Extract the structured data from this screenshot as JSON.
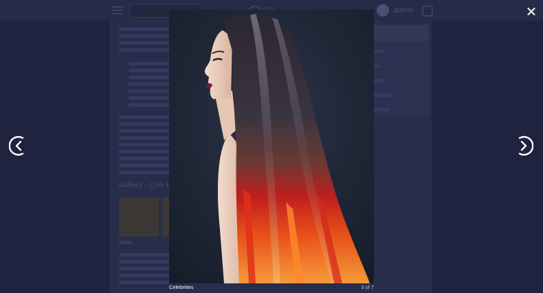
{
  "background_page": {
    "header": {
      "logo_text": "Clo",
      "username": "admin",
      "menu_icon": "hamburger-icon",
      "logout_icon": "logout-icon"
    },
    "gallery_heading": "Gallery – Link to m"
  },
  "lightbox": {
    "close_icon": "close-icon",
    "close_symbol": "✕",
    "prev_icon": "chevron-left-circle-icon",
    "next_icon": "chevron-right-circle-icon",
    "caption": "Celebrities",
    "counter": "3 of 7",
    "image_subject": "woman-profile-ombre-hair"
  },
  "colors": {
    "overlay_bg": "#1f2340",
    "hair_dark": "#2a2630",
    "hair_red": "#c81e1e",
    "hair_orange": "#f07818",
    "lips": "#7a1640",
    "white": "#ffffff"
  }
}
